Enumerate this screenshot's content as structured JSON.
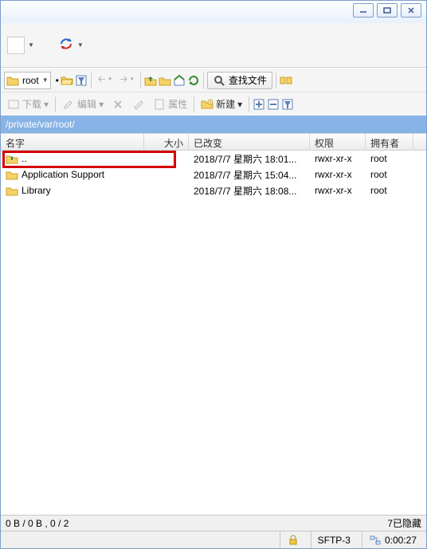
{
  "address": {
    "label": "root"
  },
  "toolbar2": {
    "find_label": "查找文件"
  },
  "toolbar3": {
    "download": "下载",
    "edit": "编辑",
    "props": "属性",
    "new": "新建"
  },
  "pathbar": {
    "path": "/private/var/root/"
  },
  "columns": {
    "name": "名字",
    "size": "大小",
    "modified": "已改变",
    "perm": "权限",
    "owner": "拥有者"
  },
  "rows": [
    {
      "name": "..",
      "size": "",
      "modified": "2018/7/7 星期六 18:01...",
      "perm": "rwxr-xr-x",
      "owner": "root",
      "up": true
    },
    {
      "name": "Application Support",
      "size": "",
      "modified": "2018/7/7 星期六 15:04...",
      "perm": "rwxr-xr-x",
      "owner": "root",
      "up": false
    },
    {
      "name": "Library",
      "size": "",
      "modified": "2018/7/7 星期六 18:08...",
      "perm": "rwxr-xr-x",
      "owner": "root",
      "up": false
    }
  ],
  "status": {
    "left": "0 B / 0 B , 0 / 2",
    "right": "7已隐藏"
  },
  "status2": {
    "proto": "SFTP-3",
    "time": "0:00:27"
  }
}
